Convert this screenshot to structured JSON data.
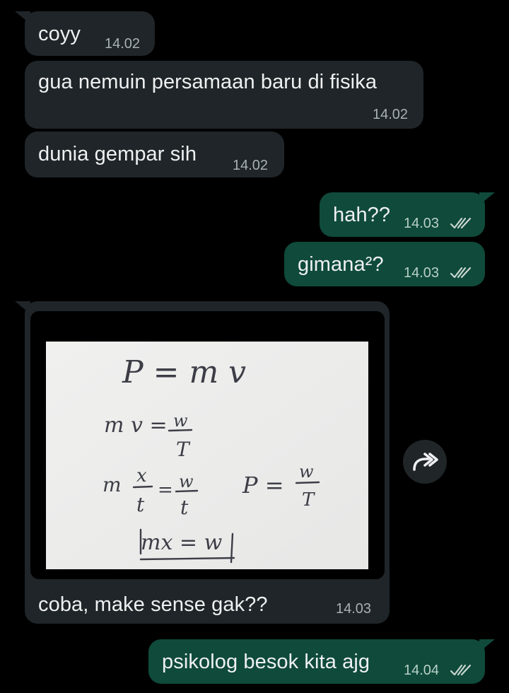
{
  "messages": [
    {
      "id": "m1",
      "direction": "incoming",
      "text": "coyy",
      "time": "14.02"
    },
    {
      "id": "m2",
      "direction": "incoming",
      "text": "gua nemuin persamaan baru di fisika",
      "time": "14.02"
    },
    {
      "id": "m3",
      "direction": "incoming",
      "text": "dunia gempar sih",
      "time": "14.02"
    },
    {
      "id": "m4",
      "direction": "outgoing",
      "text": "hah??",
      "time": "14.03",
      "status": "read"
    },
    {
      "id": "m5",
      "direction": "outgoing",
      "text": "gimana²?",
      "time": "14.03",
      "status": "read"
    },
    {
      "id": "m6",
      "direction": "incoming",
      "type": "image",
      "caption": "coba, make sense gak??",
      "time": "14.03",
      "image_icon": "handwritten-equations-photo",
      "handwriting": {
        "line1": "P = m v",
        "line2_left": "m v =",
        "line2_num": "w",
        "line2_den": "T",
        "line3_left": "m",
        "line3_num": "x",
        "line3_den": "t",
        "line3_eq": "=",
        "line3_rnum": "w",
        "line3_rden": "t",
        "side_left": "P =",
        "side_num": "w",
        "side_den": "T",
        "boxed": "mx = w"
      }
    },
    {
      "id": "m7",
      "direction": "outgoing",
      "text": "psikolog besok kita ajg",
      "time": "14.04",
      "status": "read"
    }
  ],
  "actions": {
    "forward_icon": "forward-icon"
  },
  "colors": {
    "background": "#000000",
    "incoming_bubble": "#1f2528",
    "outgoing_bubble": "#0f4a3a",
    "text": "#eef0f1",
    "time_incoming": "#a9b1b4",
    "time_outgoing": "#b8d0c6",
    "read_ticks": "#c9d6d0"
  }
}
